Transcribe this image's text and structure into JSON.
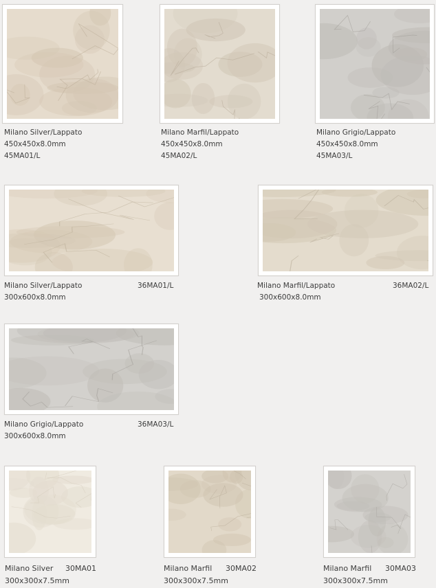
{
  "products": [
    {
      "id": "t1",
      "name": "Milano Silver/Lappato",
      "size": "450x450x8.0mm",
      "code": "45MA01/L",
      "base": "#e6dccd",
      "accent": "#d4c6b2",
      "vein": "#b9ab96"
    },
    {
      "id": "t2",
      "name": "Milano Marfil/Lappato",
      "size": "450x450x8.0mm",
      "code": "45MA02/L",
      "base": "#e3dccf",
      "accent": "#d1c7b6",
      "vein": "#b4a896"
    },
    {
      "id": "t3",
      "name": "Milano Grigio/Lappato",
      "size": "450x450x8.0mm",
      "code": "45MA03/L",
      "base": "#d1cfcb",
      "accent": "#bebbb6",
      "vein": "#a09c97"
    },
    {
      "id": "t4",
      "name": "Milano Silver/Lappato",
      "size": "300x600x8.0mm",
      "code": "36MA01/L",
      "base": "#e8dfd1",
      "accent": "#d5c8b4",
      "vein": "#bcae99"
    },
    {
      "id": "t5",
      "name": "Milano Marfil/Lappato",
      "size": "300x600x8.0mm",
      "code": "36MA02/L",
      "base": "#e4dccd",
      "accent": "#d2c7b4",
      "vein": "#b7ab98"
    },
    {
      "id": "t6",
      "name": "Milano Grigio/Lappato",
      "size": "300x600x8.0mm",
      "code": "36MA03/L",
      "base": "#d3d1cd",
      "accent": "#bfbcb7",
      "vein": "#a29e99"
    },
    {
      "id": "t7",
      "name": "Milano Silver",
      "size": "300x300x7.5mm",
      "code": "30MA01",
      "base": "#f0ebe1",
      "accent": "#e3dccf",
      "vein": "#cfc6b6"
    },
    {
      "id": "t8",
      "name": "Milano Marfil",
      "size": "300x300x7.5mm",
      "code": "30MA02",
      "base": "#e2d9c9",
      "accent": "#d0c4b0",
      "vein": "#b3a692"
    },
    {
      "id": "t9",
      "name": "Milano Marfil",
      "size": "300x300x7.5mm",
      "code": "30MA03",
      "base": "#d4d2ce",
      "accent": "#c0bdb8",
      "vein": "#a19d98"
    }
  ]
}
